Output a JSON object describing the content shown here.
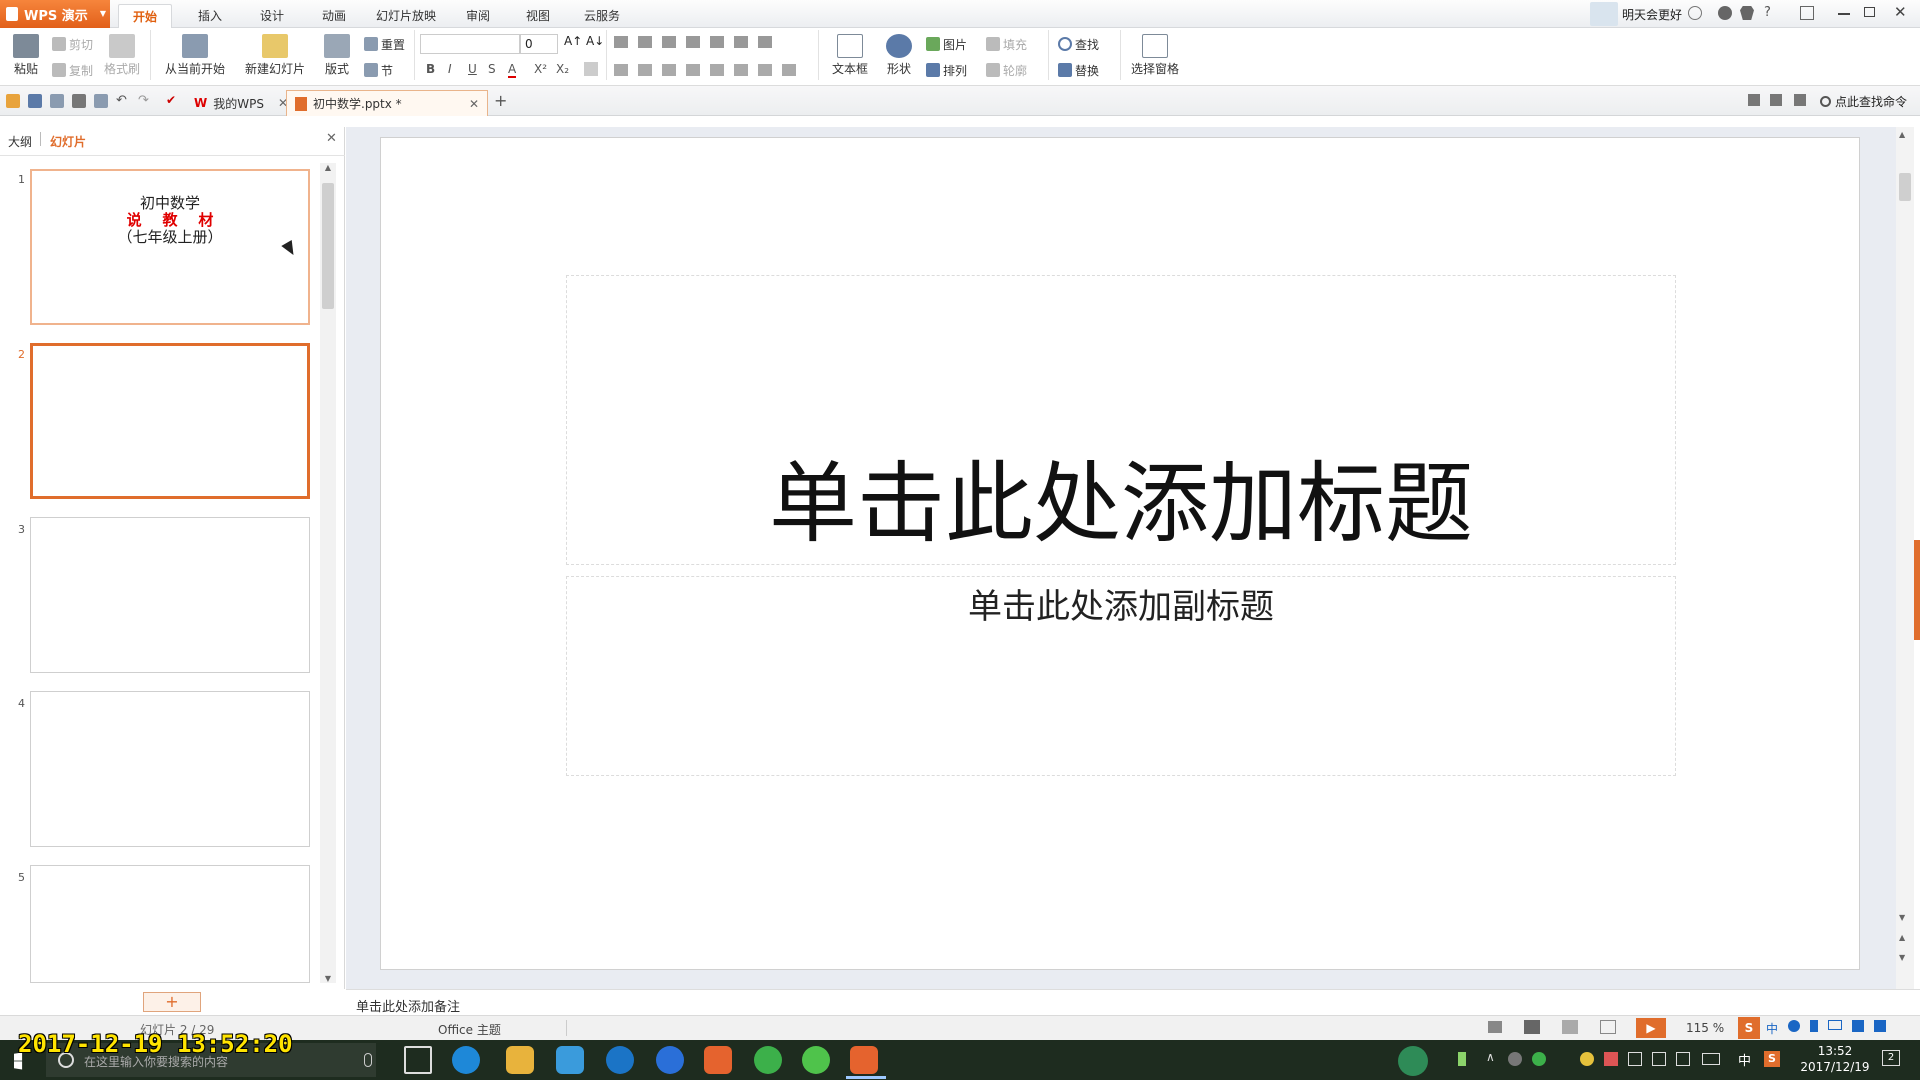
{
  "app": {
    "name": "WPS 演示"
  },
  "menu": {
    "tabs": [
      "开始",
      "插入",
      "设计",
      "动画",
      "幻灯片放映",
      "审阅",
      "视图",
      "云服务"
    ],
    "user": "明天会更好",
    "help": "?"
  },
  "ribbon": {
    "paste": "粘贴",
    "cut": "剪切",
    "copy": "复制",
    "format_painter": "格式刷",
    "from_current": "从当前开始",
    "new_slide": "新建幻灯片",
    "layout": "版式",
    "reset": "重置",
    "section": "节",
    "font_name": "",
    "font_size": "0",
    "bold": "B",
    "italic": "I",
    "underline": "U",
    "strike": "S",
    "font_color": "A",
    "superscript": "X²",
    "subscript": "X₂",
    "textbox": "文本框",
    "shape": "形状",
    "picture": "图片",
    "arrange": "排列",
    "fill": "填充",
    "outline": "轮廓",
    "find": "查找",
    "replace": "替换",
    "selection_pane": "选择窗格"
  },
  "doc_tabs": [
    {
      "label": "我的WPS"
    },
    {
      "label": "初中数学.pptx *"
    }
  ],
  "search_cmd": "点此查找命令",
  "panel": {
    "outline_tab": "大纲",
    "slides_tab": "幻灯片"
  },
  "thumbnails": [
    {
      "num": "1",
      "line1": "初中数学",
      "line2": "说    教    材",
      "line3": "（七年级上册）"
    },
    {
      "num": "2"
    },
    {
      "num": "3"
    },
    {
      "num": "4"
    },
    {
      "num": "5"
    }
  ],
  "slide": {
    "title_placeholder": "单击此处添加标题",
    "subtitle_placeholder": "单击此处添加副标题"
  },
  "notes": {
    "placeholder": "单击此处添加备注"
  },
  "status": {
    "slide_counter": "幻灯片 2 / 29",
    "theme": "Office 主题",
    "zoom": "115 %"
  },
  "taskbar": {
    "search_placeholder": "在这里输入你要搜索的内容",
    "time": "13:52",
    "date": "2017/12/19",
    "ime": "中",
    "notif_count": "2"
  },
  "overlay": {
    "timestamp": "2017-12-19 13:52:20"
  },
  "colors": {
    "accent": "#e06d2c",
    "red_text": "#e00000",
    "taskbar": "#1e2c1f"
  }
}
